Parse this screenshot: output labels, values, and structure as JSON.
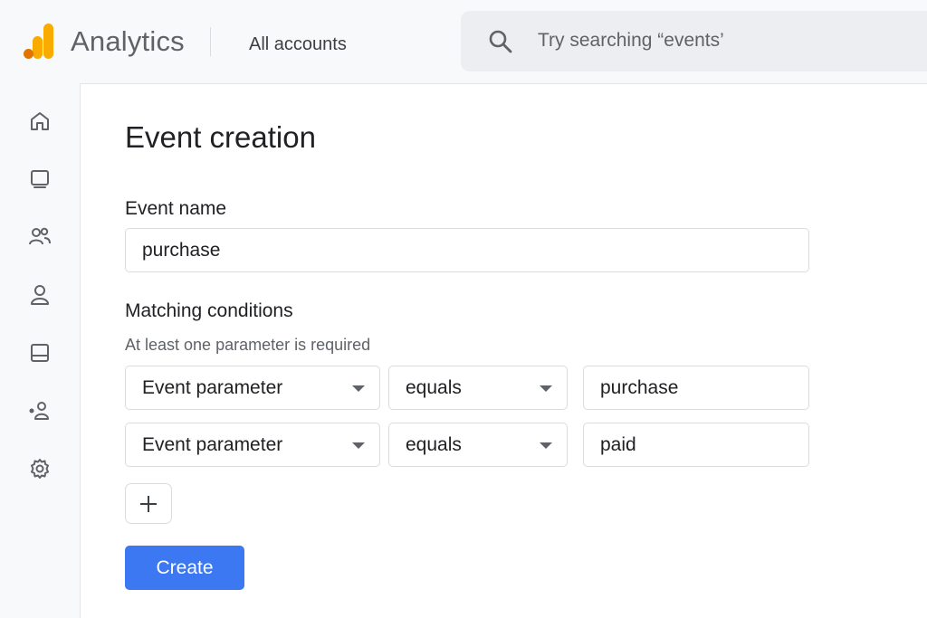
{
  "header": {
    "brand": "Analytics",
    "accounts_label": "All accounts",
    "search_placeholder": "Try searching “events’"
  },
  "sidebar": {
    "items": [
      {
        "name": "home",
        "icon": "home-icon"
      },
      {
        "name": "reports",
        "icon": "reports-icon"
      },
      {
        "name": "audiences",
        "icon": "people-icon"
      },
      {
        "name": "user",
        "icon": "person-icon"
      },
      {
        "name": "library",
        "icon": "library-icon"
      },
      {
        "name": "admin-users",
        "icon": "user-admin-icon"
      },
      {
        "name": "settings",
        "icon": "gear-icon"
      }
    ]
  },
  "form": {
    "title": "Event creation",
    "event_name_label": "Event name",
    "event_name_value": "purchase",
    "matching_label": "Matching conditions",
    "matching_helper": "At least one parameter is required",
    "conditions": [
      {
        "parameter": "Event parameter",
        "operator": "equals",
        "value": "purchase"
      },
      {
        "parameter": "Event parameter",
        "operator": "equals",
        "value": "paid"
      }
    ],
    "add_button_symbol": "+",
    "create_label": "Create"
  },
  "colors": {
    "accent": "#3b78f2",
    "logo_orange": "#f9ab00",
    "logo_dark_orange": "#e37400"
  }
}
